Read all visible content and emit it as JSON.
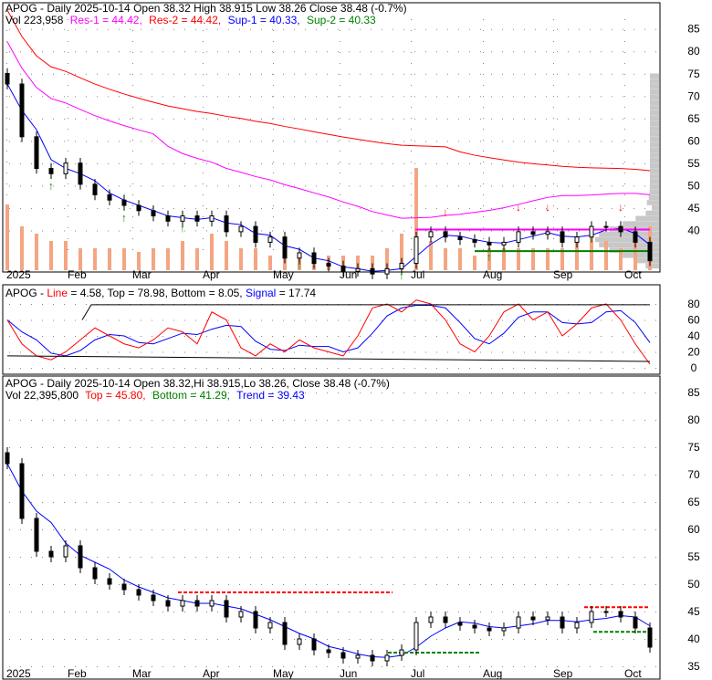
{
  "chart_data": [
    {
      "type": "candlestick",
      "ticker": "APOG",
      "header_line1": "APOG - Daily 2025-10-14 Open 38.32  High 38.915  Low 38.26  Close 38.48 (-0.7%)",
      "header_vol": "Vol 223,958",
      "levels": [
        {
          "label": "Res-1 = 44.42,",
          "value": 44.42,
          "color": "#ff00ff"
        },
        {
          "label": "Res-2 = 44.42,",
          "value": 44.42,
          "color": "#ff0000"
        },
        {
          "label": "Sup-1 = 40.33,",
          "value": 40.33,
          "color": "#0000ff"
        },
        {
          "label": "Sup-2 = 40.33",
          "value": 40.33,
          "color": "#008000"
        }
      ],
      "ylim": [
        35,
        88
      ],
      "yticks": [
        "85",
        "80",
        "75",
        "70",
        "65",
        "60",
        "55",
        "50",
        "45",
        "40"
      ],
      "xticks": [
        "2025",
        "Feb",
        "Mar",
        "Apr",
        "May",
        "Jun",
        "Jul",
        "Aug",
        "Sep",
        "Oct"
      ],
      "closes": [
        72,
        62,
        56,
        55,
        57,
        53,
        51,
        50,
        49,
        48,
        47,
        46,
        47,
        46,
        47,
        44,
        45,
        42,
        43,
        39,
        40,
        38,
        37.5,
        36.5,
        37,
        36,
        37,
        38,
        43,
        44,
        43,
        42.5,
        42,
        41.5,
        42,
        44,
        43.5,
        44,
        42,
        43,
        45,
        45,
        44,
        42,
        38.5
      ],
      "volumes": [
        9,
        6,
        5,
        4,
        4,
        3,
        3,
        3,
        3,
        2.5,
        3,
        3,
        4,
        3,
        5,
        4,
        3,
        3,
        2,
        2,
        2,
        2,
        2,
        2,
        2,
        2,
        3,
        5,
        14,
        4,
        3,
        3,
        2,
        3,
        3,
        3,
        3,
        3,
        3,
        4,
        5,
        4,
        3,
        4,
        6
      ]
    },
    {
      "type": "line",
      "title_prefix": "APOG - ",
      "series_labels": [
        {
          "label": "Line",
          "value": "= 4.58,",
          "color": "#ff0000"
        },
        {
          "label": "Top = 78.98, Bottom = 8.05,",
          "value": "",
          "color": "#000000"
        },
        {
          "label": "Signal",
          "value": "= 17.74",
          "color": "#0000ff"
        }
      ],
      "ylim": [
        0,
        90
      ],
      "yticks": [
        "80",
        "60",
        "40",
        "20",
        "0"
      ],
      "line": [
        60,
        30,
        15,
        10,
        20,
        35,
        50,
        40,
        30,
        25,
        35,
        50,
        45,
        30,
        70,
        60,
        25,
        15,
        30,
        20,
        35,
        25,
        20,
        15,
        40,
        75,
        80,
        70,
        85,
        80,
        60,
        30,
        20,
        40,
        70,
        80,
        60,
        70,
        40,
        55,
        75,
        80,
        60,
        30,
        4.58
      ]
    },
    {
      "type": "candlestick",
      "header_line1": "APOG - Daily 2025-10-14 Open 38.32,Hi 38.915,Lo 38.26, Close 38.48 (-0.7%)",
      "header_vol": "Vol 22,395,800",
      "labels": [
        {
          "label": "Top = 45.80,",
          "value": 45.8,
          "color": "#ff0000"
        },
        {
          "label": "Bottom = 41.29,",
          "value": 41.29,
          "color": "#008000"
        },
        {
          "label": "Trend = 39.43",
          "value": 39.43,
          "color": "#0000ff"
        }
      ],
      "ylim": [
        34,
        88
      ],
      "yticks": [
        "85",
        "80",
        "75",
        "70",
        "65",
        "60",
        "55",
        "50",
        "45",
        "40",
        "35"
      ],
      "xticks": [
        "2025",
        "Feb",
        "Mar",
        "Apr",
        "May",
        "Jun",
        "Jul",
        "Aug",
        "Sep",
        "Oct"
      ]
    }
  ]
}
